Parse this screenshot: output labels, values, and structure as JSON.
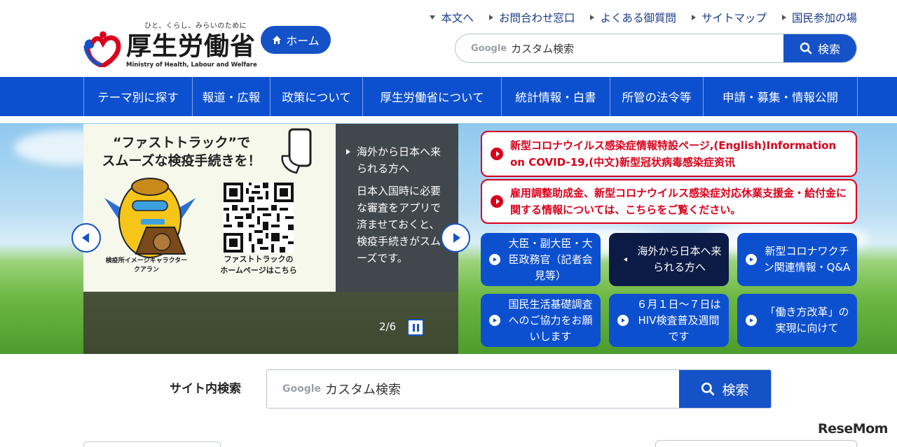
{
  "header": {
    "logo": {
      "tagline": "ひと、くらし、みらいのために",
      "title": "厚生労働省",
      "english": "Ministry of Health, Labour and Welfare"
    },
    "home_label": "ホーム",
    "util_nav": [
      {
        "label": "本文へ",
        "icon": "triangle-down-icon"
      },
      {
        "label": "お問合わせ窓口",
        "icon": "triangle-right-icon"
      },
      {
        "label": "よくある御質問",
        "icon": "triangle-right-icon"
      },
      {
        "label": "サイトマップ",
        "icon": "triangle-right-icon"
      },
      {
        "label": "国民参加の場",
        "icon": "triangle-right-icon"
      }
    ],
    "search": {
      "google_label": "Google",
      "placeholder": "カスタム検索",
      "button_label": "検索"
    }
  },
  "global_nav": [
    "テーマ別に探す",
    "報道・広報",
    "政策について",
    "厚生労働省について",
    "統計情報・白書",
    "所管の法令等",
    "申請・募集・情報公開"
  ],
  "hero": {
    "slide": {
      "headline_line1": "“ファストトラック”で",
      "headline_line2": "スムーズな検疫手続きを！",
      "mascot_caption_line1": "検疫所イメージキャラクター",
      "mascot_caption_line2": "クアラン",
      "qr_caption_line1": "ファストトラックの",
      "qr_caption_line2": "ホームページはこちら",
      "side_title": "海外から日本へ来られる方へ",
      "side_body": "日本入国時に必要な審査をアプリで済ませておくと、検疫手続きがスムーズです。",
      "counter": "2/6"
    },
    "alerts": [
      "新型コロナウイルス感染症情報特設ページ,(English)Information on COVID-19,(中文)新型冠状病毒感染症资讯",
      "雇用調整助成金、新型コロナウイルス感染症対応休業支援金・給付金に関する情報については、こちらをご覧ください。"
    ],
    "quick_links": [
      {
        "label": "大臣・副大臣・大臣政務官（記者会見等）",
        "style": "blue"
      },
      {
        "label": "海外から日本へ来られる方へ",
        "style": "dark"
      },
      {
        "label": "新型コロナワクチン関連情報・Q&A",
        "style": "blue"
      },
      {
        "label": "国民生活基礎調査へのご協力をお願いします",
        "style": "blue"
      },
      {
        "label": "６月１日〜７日はHIV検査普及週間です",
        "style": "blue"
      },
      {
        "label": "「働き方改革」の実現に向けて",
        "style": "blue"
      }
    ]
  },
  "site_search": {
    "label": "サイト内検索",
    "google_label": "Google",
    "placeholder": "カスタム検索",
    "button_label": "検索"
  },
  "watermark": "ReseMom",
  "colors": {
    "primary_blue": "#0d50cf",
    "dark_navy": "#0c1b46",
    "alert_red": "#d9001b"
  }
}
